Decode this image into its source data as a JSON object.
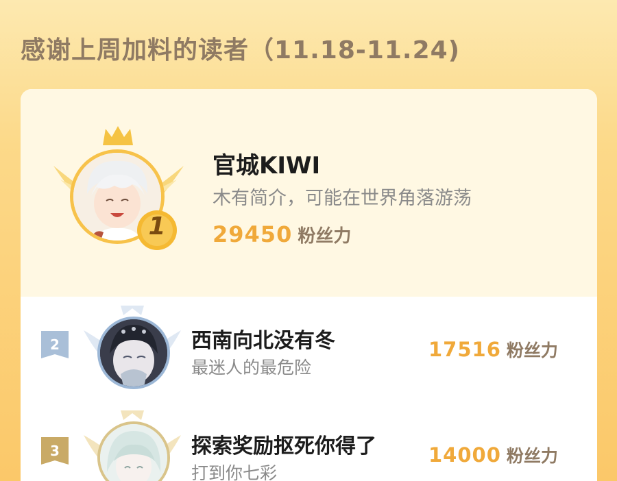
{
  "header": {
    "title": "感谢上周加料的读者（11.18-11.24)"
  },
  "leaderboard": [
    {
      "rank": "1",
      "name": "官城KIWI",
      "bio": "木有简介，可能在世界角落游荡",
      "score": "29450",
      "unit": "粉丝力"
    },
    {
      "rank": "2",
      "name": "西南向北没有冬",
      "bio": "最迷人的最危险",
      "score": "17516",
      "unit": "粉丝力"
    },
    {
      "rank": "3",
      "name": "探索奖励抠死你得了",
      "bio": "打到你七彩",
      "score": "14000",
      "unit": "粉丝力"
    }
  ],
  "colors": {
    "accent": "#f0a93a",
    "gold": "#f7c24a",
    "silver": "#a9bfd8",
    "bronze": "#c9aa66"
  }
}
